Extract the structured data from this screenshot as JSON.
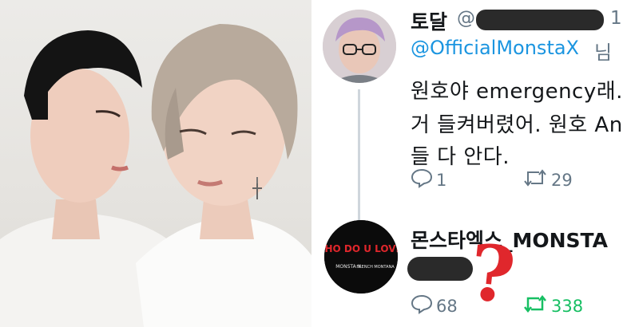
{
  "tweet1": {
    "display_name": "토달",
    "handle_prefix": "@",
    "trailing_text": "1",
    "mention": "@OfficialMonstaX",
    "mention_suffix": "님",
    "lines": [
      "원호야 emergency래.",
      "거 들켜버렸어. 원호 Ang",
      "들 다 안다."
    ],
    "replies": "1",
    "retweets": "29"
  },
  "tweet2": {
    "display_name": "몬스타엑스_MONSTA",
    "replies": "68",
    "retweets": "338",
    "avatar_text": [
      "WHO DO U LOVE?",
      "MONSTA X",
      "FRENCH MONTANA"
    ]
  },
  "annotation": {
    "mark": "?"
  },
  "colors": {
    "link": "#1b95e0",
    "muted": "#657786",
    "retweet_active": "#17bf63",
    "annotation": "#e0272c"
  }
}
